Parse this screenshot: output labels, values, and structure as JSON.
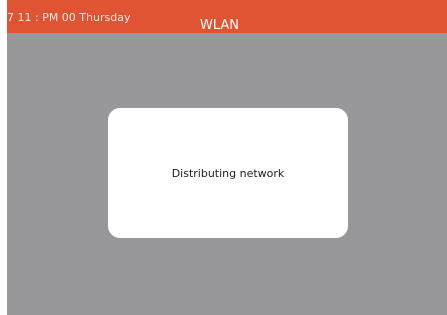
{
  "status_bar": {
    "time_text": "7 11 : PM 00 Thursday",
    "title": "WLAN",
    "background_color": "#e05333"
  },
  "overlay": {
    "background_color": "#98989b"
  },
  "dialog": {
    "message": "Distributing network"
  }
}
